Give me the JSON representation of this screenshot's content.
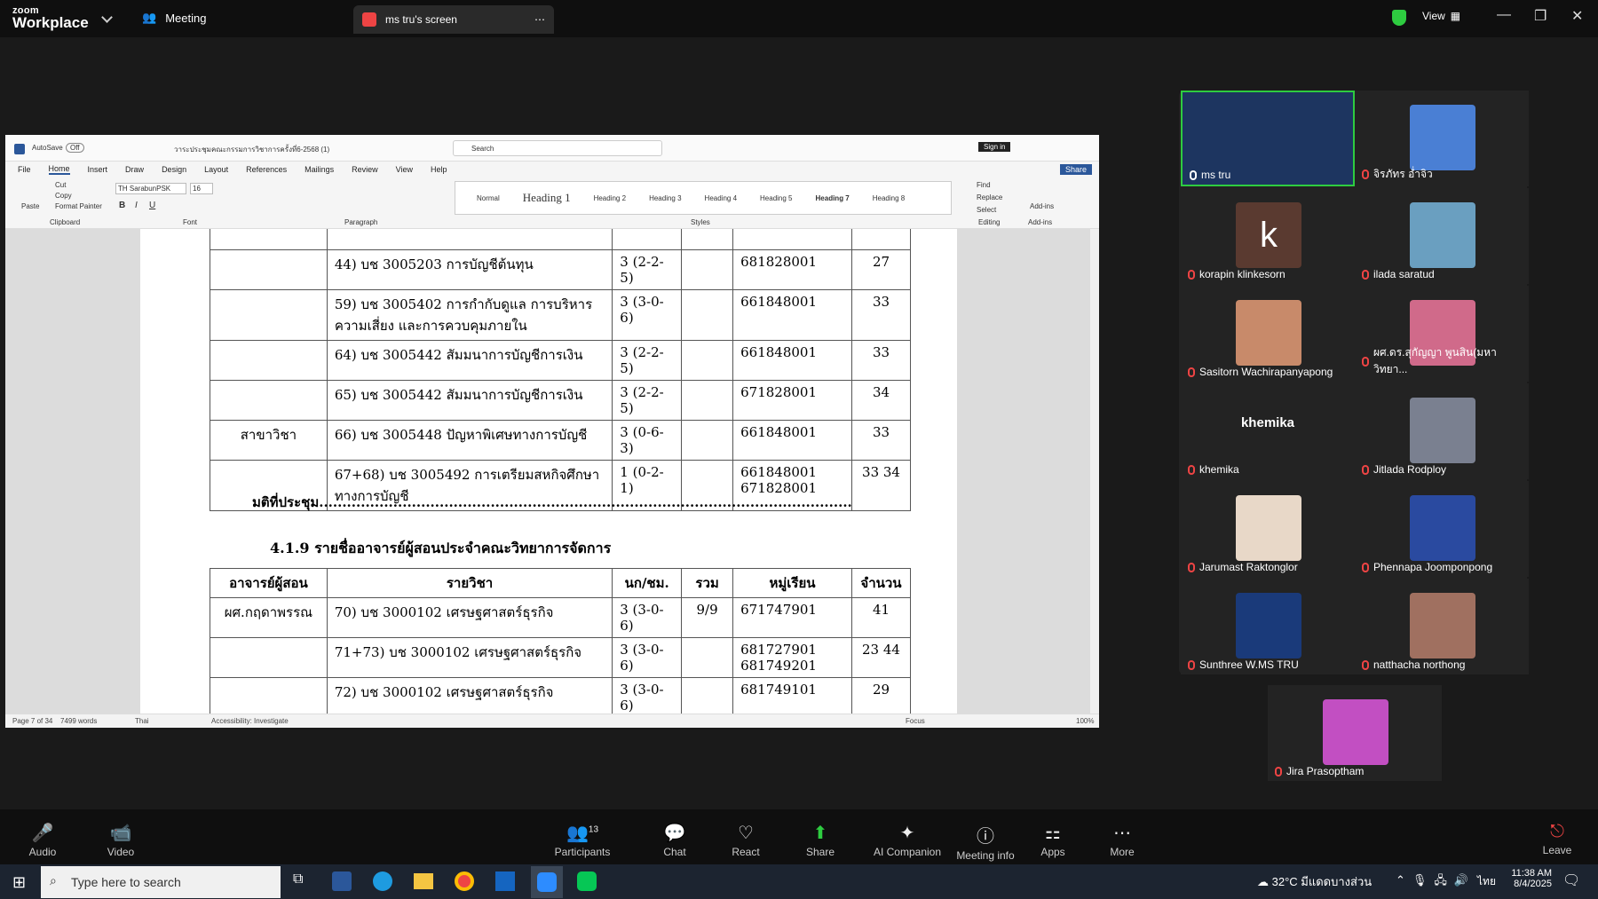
{
  "app": {
    "logo_top": "zoom",
    "logo_bottom": "Workplace",
    "meeting_tab": "Meeting",
    "screen_tab": "ms tru's screen",
    "view": "View",
    "accent": "#2d8cff"
  },
  "word": {
    "autosave": "AutoSave",
    "toggle": "Off",
    "filename": "วาระประชุมคณะกรรมการวิชาการครั้งที่6-2568 (1)",
    "search": "Search",
    "signin": "Sign in",
    "menu": [
      "File",
      "Home",
      "Insert",
      "Draw",
      "Design",
      "Layout",
      "References",
      "Mailings",
      "Review",
      "View",
      "Help"
    ],
    "share": "Share",
    "font": "TH SarabunPSK",
    "size": "16",
    "styles": [
      "Normal",
      "Heading 1",
      "Heading 2",
      "Heading 3",
      "Heading 4",
      "Heading 5",
      "Heading 7",
      "Heading 8"
    ],
    "groups": [
      "Clipboard",
      "Font",
      "Paragraph",
      "Styles",
      "Editing",
      "Add-ins"
    ],
    "editing": [
      "Find",
      "Replace",
      "Select"
    ],
    "addins": "Add-ins",
    "clip": [
      "Paste",
      "Cut",
      "Copy",
      "Format Painter"
    ],
    "status": {
      "page": "Page 7 of 34",
      "words": "7499 words",
      "lang": "Thai",
      "access": "Accessibility: Investigate",
      "focus": "Focus",
      "zoom": "100%"
    }
  },
  "doc": {
    "rows1": [
      {
        "c1": "",
        "c2": "44) บช 3005203 การบัญชีต้นทุน",
        "c3": "3 (2-2-5)",
        "c4": "681828001",
        "c5": "27"
      },
      {
        "c1": "",
        "c2": "59) บช 3005402 การกำกับดูแล การบริหารความเสี่ยง และการควบคุมภายใน",
        "c3": "3 (3-0-6)",
        "c4": "661848001",
        "c5": "33"
      },
      {
        "c1": "",
        "c2": "64) บช 3005442 สัมมนาการบัญชีการเงิน",
        "c3": "3 (2-2-5)",
        "c4": "661848001",
        "c5": "33"
      },
      {
        "c1": "",
        "c2": "65) บช 3005442 สัมมนาการบัญชีการเงิน",
        "c3": "3 (2-2-5)",
        "c4": "671828001",
        "c5": "34"
      },
      {
        "c1": "สาขาวิชา",
        "c2": "66) บช 3005448 ปัญหาพิเศษทางการบัญชี",
        "c3": "3 (0-6-3)",
        "c4": "661848001",
        "c5": "33"
      },
      {
        "c1": "",
        "c2": "67+68) บช 3005492 การเตรียมสหกิจศึกษาทางการบัญชี",
        "c3": "1 (0-2-1)",
        "c4": "661848001 671828001",
        "c5": "33 34"
      }
    ],
    "resolution": "มติที่ประชุม...................................................................................................................",
    "heading": "4.1.9 รายชื่ออาจารย์ผู้สอนประจำคณะวิทยาการจัดการ",
    "headers": [
      "อาจารย์ผู้สอน",
      "รายวิชา",
      "นก/ชม.",
      "รวม",
      "หมู่เรียน",
      "จำนวน"
    ],
    "rows2": [
      {
        "c1": "ผศ.กฤดาพรรณ",
        "c2": "70) บช 3000102 เศรษฐศาสตร์ธุรกิจ",
        "c3": "3 (3-0-6)",
        "c4": "9/9",
        "c5": "671747901",
        "c6": "41"
      },
      {
        "c1": "",
        "c2": "71+73) บช 3000102 เศรษฐศาสตร์ธุรกิจ",
        "c3": "3 (3-0-6)",
        "c4": "",
        "c5": "681727901 681749201",
        "c6": "23 44"
      },
      {
        "c1": "",
        "c2": "72) บช 3000102 เศรษฐศาสตร์ธุรกิจ",
        "c3": "3 (3-0-6)",
        "c4": "",
        "c5": "681749101",
        "c6": "29"
      }
    ]
  },
  "participants": [
    {
      "name": "ms tru",
      "avatar": "#3a5a8a",
      "initial": ""
    },
    {
      "name": "จิรภัทร อ่ำจิว",
      "avatar": "#4a7fd4",
      "initial": ""
    },
    {
      "name": "korapin klinkesorn",
      "avatar": "#5a3a30",
      "initial": "k"
    },
    {
      "name": "ilada saratud",
      "avatar": "#6a9fc0",
      "initial": ""
    },
    {
      "name": "Sasitorn Wachirapanyapong",
      "avatar": "#c88a6a",
      "initial": ""
    },
    {
      "name": "ผศ.ดร.สุกัญญา พูนสิน(มหาวิทยา...",
      "avatar": "#d06a8a",
      "initial": ""
    },
    {
      "name": "khemika",
      "avatar": "#232323",
      "initial": "khemika"
    },
    {
      "name": "Jitlada Rodploy",
      "avatar": "#7a8090",
      "initial": ""
    },
    {
      "name": "Jarumast Raktonglor",
      "avatar": "#e8d8c8",
      "initial": ""
    },
    {
      "name": "Phennapa Joomponpong",
      "avatar": "#2a4aa0",
      "initial": ""
    },
    {
      "name": "Sunthree W.MS TRU",
      "avatar": "#1a3a7a",
      "initial": ""
    },
    {
      "name": "natthacha northong",
      "avatar": "#a07060",
      "initial": ""
    },
    {
      "name": "Jira Prasoptham",
      "avatar": "#c24fc2",
      "initial": ""
    }
  ],
  "bottom": [
    "Audio",
    "Video",
    "Participants",
    "Chat",
    "React",
    "Share",
    "AI Companion",
    "Meeting info",
    "Apps",
    "More",
    "Leave"
  ],
  "participant_count": "13",
  "taskbar": {
    "search": "Type here to search",
    "weather": "32°C มีแดดบางส่วน",
    "lang": "ไทย",
    "time": "11:38 AM",
    "date": "8/4/2025"
  }
}
